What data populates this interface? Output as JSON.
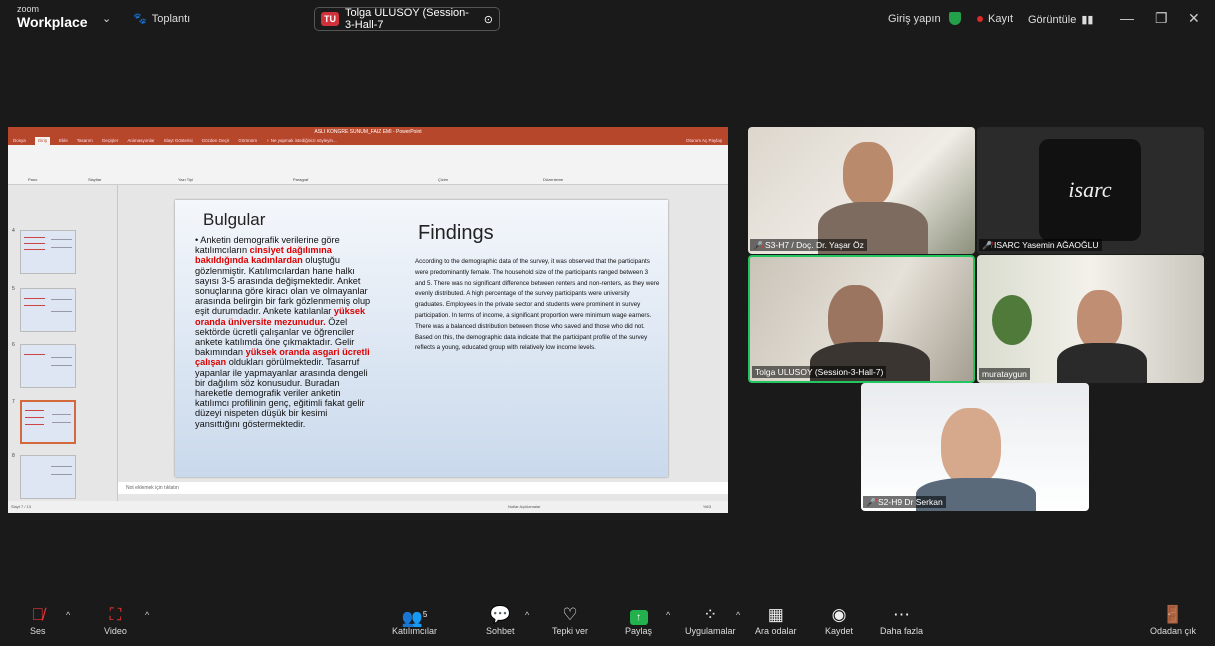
{
  "app": {
    "brand_top": "zoom",
    "brand_bottom": "Workplace",
    "meeting_label": "Toplantı",
    "share_user_badge": "TU",
    "share_title": "Tolga ULUSOY (Session-3-Hall-7",
    "signin": "Giriş yapın",
    "record": "Kayıt",
    "view": "Görüntüle"
  },
  "ppt": {
    "window_title": "ASLI KONGRE SUNUM_FAIZ EMI - PowerPoint",
    "tabs": [
      "Dosya",
      "Giriş",
      "Ekle",
      "Tasarım",
      "Geçişler",
      "Animasyonlar",
      "Slayt Gösterisi",
      "Gözden Geçir",
      "Görünüm",
      "♀ Ne yapmak istediğinizi söyleyin..."
    ],
    "account": "Oturum Aç  Paylaş",
    "groups": [
      "Pano",
      "Slaytlar",
      "Yazı Tipi",
      "Paragraf",
      "Çizim",
      "Düzenleme"
    ],
    "thumb_numbers": [
      "4",
      "5",
      "6",
      "7",
      "8"
    ],
    "notes_placeholder": "Not eklemek için tıklatın",
    "status_left": "Slayt 7 / 13",
    "status_right": "Notlar   Açıklamalar",
    "zoom": "%63"
  },
  "slide": {
    "title_tr": "Bulgular",
    "title_en": "Findings",
    "tr_part1": "Anketin demografik verilerine göre katılımcıların ",
    "tr_red1": "cinsiyet dağılımına bakıldığında kadınlardan",
    "tr_part2": " oluştuğu gözlenmiştir. Katılımcılardan hane halkı sayısı 3-5 arasında değişmektedir. Anket sonuçlarına göre kiracı olan ve olmayanlar arasında belirgin bir fark gözlenmemiş olup eşit durumdadır. Ankete katılanlar ",
    "tr_red2": "yüksek oranda üniversite mezunudur.",
    "tr_part3": " Özel sektörde ücretli çalışanlar ve öğrenciler ankete katılımda öne çıkmaktadır. Gelir bakımından ",
    "tr_red3": "yüksek oranda asgari ücretli çalışan",
    "tr_part4": " oldukları görülmektedir. Tasarruf yapanlar ile yapmayanlar arasında dengeli bir dağılım söz konusudur. Buradan hareketle demografik veriler anketin katılımcı profilinin genç, eğitimli fakat gelir düzeyi nispeten düşük bir kesimi yansıttığını göstermektedir.",
    "en_body": "According to the demographic data of the survey, it was observed that the participants were predominantly female. The household size of the participants ranged between 3 and 5. There was no significant difference between renters and non-renters, as they were evenly distributed. A high percentage of the survey participants were university graduates. Employees in the private sector and students were prominent in survey participation. In terms of income, a significant proportion were minimum wage earners. There was a balanced distribution between those who saved and those who did not. Based on this, the demographic data indicate that the participant profile of the survey reflects a young, educated group with relatively low income levels."
  },
  "participants": [
    {
      "name": "S3-H7 / Doç. Dr. Yaşar Öz",
      "muted": true
    },
    {
      "name": "ISARC Yasemin AĞAOĞLU",
      "muted": true,
      "logo_text": "isarc"
    },
    {
      "name": "Tolga ULUSOY (Session-3-Hall-7)",
      "muted": false
    },
    {
      "name": "murataygun",
      "muted": false
    },
    {
      "name": "S2-H9 Dr Serkan",
      "muted": true
    }
  ],
  "toolbar": {
    "audio": "Ses",
    "video": "Video",
    "participants": "Katılımcılar",
    "participants_count": "5",
    "chat": "Sohbet",
    "react": "Tepki ver",
    "share": "Paylaş",
    "apps": "Uygulamalar",
    "breakout": "Ara odalar",
    "record": "Kaydet",
    "more": "Daha fazla",
    "leave": "Odadan çık"
  },
  "colors": {
    "ppt_accent": "#b7472a",
    "active_speaker": "#23c55e",
    "share_green": "#22b14c",
    "leave_red": "#e0242c"
  }
}
